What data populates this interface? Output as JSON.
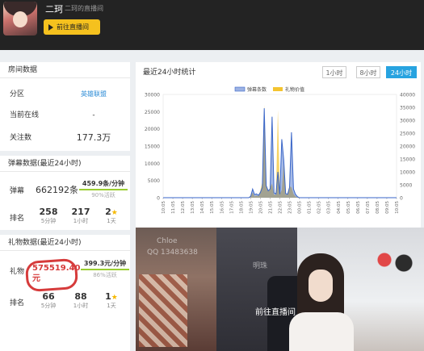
{
  "header": {
    "streamer_name": "二珂",
    "streamer_subtitle": "二珂的直播间",
    "goto_button": "前往直播间"
  },
  "room": {
    "title": "房间数据",
    "rows": [
      {
        "key": "分区",
        "value": "英雄联盟"
      },
      {
        "key": "当前在线",
        "value": "-"
      },
      {
        "key": "关注数",
        "value": "177.3万"
      }
    ]
  },
  "danmaku": {
    "title": "弹幕数据(最近24小时)",
    "label": "弹幕",
    "count": "662192条",
    "rate": "459.9条/分钟",
    "rate_note": "90%活跃",
    "rank_label": "排名",
    "ranks": [
      {
        "value": "258",
        "sub": "5分钟",
        "star": false
      },
      {
        "value": "217",
        "sub": "1小时",
        "star": false
      },
      {
        "value": "2",
        "sub": "1天",
        "star": true
      }
    ]
  },
  "gift": {
    "title": "礼物数据(最近24小时)",
    "label": "礼物",
    "amount_line1": "575519.40",
    "amount_line2": "元",
    "rate": "399.3元/分钟",
    "rate_note": "86%活跃",
    "rank_label": "排名",
    "ranks": [
      {
        "value": "66",
        "sub": "5分钟",
        "star": false
      },
      {
        "value": "88",
        "sub": "1小时",
        "star": false
      },
      {
        "value": "1",
        "sub": "1天",
        "star": true
      }
    ]
  },
  "chart_panel": {
    "title": "最近24小时统计",
    "tabs": [
      "1小时",
      "8小时",
      "24小时"
    ],
    "active_tab": 2
  },
  "video": {
    "button": "前往直播间",
    "overlay_left": "Chloe",
    "overlay_qq": "QQ   13483638",
    "overlay_mid": "明珠"
  },
  "chart_data": {
    "type": "area",
    "legend": [
      "弹幕条数",
      "礼物价值"
    ],
    "legend_position": "top",
    "colors": {
      "danmaku": "#3a66c8",
      "gift": "#f4c430"
    },
    "x_ticks": [
      "10:05",
      "11:05",
      "12:05",
      "13:05",
      "14:05",
      "15:05",
      "16:05",
      "17:05",
      "18:05",
      "19:05",
      "20:05",
      "21:05",
      "22:05",
      "23:05",
      "00:05",
      "01:05",
      "02:05",
      "03:05",
      "04:05",
      "05:05",
      "06:05",
      "07:05",
      "08:05",
      "09:05",
      "10:05"
    ],
    "y_left": {
      "ticks": [
        0,
        5000,
        10000,
        15000,
        20000,
        25000,
        30000
      ],
      "range": [
        0,
        30000
      ]
    },
    "y_right": {
      "ticks": [
        0,
        5000,
        10000,
        15000,
        20000,
        25000,
        30000,
        35000,
        40000
      ],
      "range": [
        0,
        40000
      ]
    },
    "danmaku_series": {
      "x": [
        0,
        8.8,
        9.0,
        9.2,
        9.4,
        9.6,
        9.8,
        10.0,
        10.2,
        10.4,
        10.6,
        10.8,
        11.0,
        11.2,
        11.4,
        11.6,
        11.8,
        12.0,
        12.2,
        12.4,
        12.6,
        12.8,
        13.0,
        13.2,
        13.4,
        13.6,
        13.8,
        14.0,
        14.3,
        24
      ],
      "values": [
        0,
        0,
        400,
        2500,
        900,
        1100,
        700,
        1500,
        3000,
        26000,
        3500,
        2000,
        2500,
        23500,
        1400,
        1100,
        7500,
        1000,
        17000,
        11000,
        1200,
        1000,
        3000,
        19000,
        2500,
        1000,
        300,
        0,
        0,
        0
      ]
    },
    "gift_series": {
      "x": [
        0,
        8.8,
        9.0,
        9.2,
        9.4,
        9.6,
        9.8,
        10.0,
        10.2,
        10.4,
        10.6,
        10.8,
        11.0,
        11.2,
        11.4,
        11.6,
        11.8,
        12.0,
        12.2,
        12.4,
        12.6,
        12.8,
        13.0,
        13.2,
        13.4,
        13.6,
        13.8,
        14.0,
        14.3,
        24
      ],
      "values": [
        0,
        0,
        800,
        2000,
        500,
        900,
        600,
        2800,
        6000,
        36000,
        5000,
        2500,
        4000,
        5500,
        1200,
        1200,
        34000,
        1500,
        3000,
        13500,
        1000,
        1800,
        4500,
        4000,
        1500,
        500,
        200,
        0,
        0,
        0
      ]
    }
  }
}
